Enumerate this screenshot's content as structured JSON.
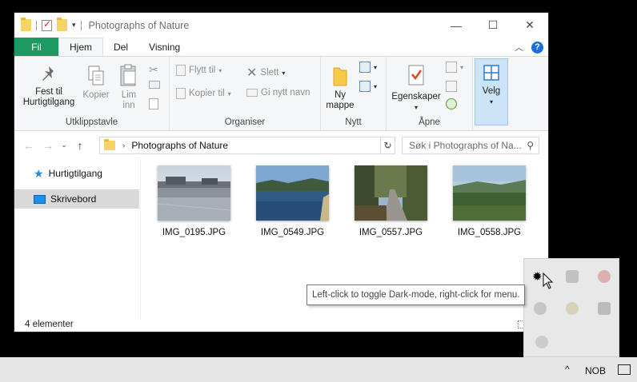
{
  "window": {
    "title": "Photographs of Nature",
    "controls": {
      "minimize": "—",
      "maximize": "☐",
      "close": "✕"
    }
  },
  "tabs": [
    {
      "label": "Fil"
    },
    {
      "label": "Hjem"
    },
    {
      "label": "Del"
    },
    {
      "label": "Visning"
    }
  ],
  "ribbon": {
    "clipboard": {
      "group_label": "Utklippstavle",
      "pin_line1": "Fest til",
      "pin_line2": "Hurtigtilgang",
      "copy": "Kopier",
      "paste_line1": "Lim",
      "paste_line2": "inn"
    },
    "organize": {
      "group_label": "Organiser",
      "move_to": "Flytt til",
      "copy_to": "Kopier til",
      "delete": "Slett",
      "rename": "Gi nytt navn"
    },
    "new": {
      "group_label": "Nytt",
      "new_folder_line1": "Ny",
      "new_folder_line2": "mappe"
    },
    "open": {
      "group_label": "Åpne",
      "properties": "Egenskaper"
    },
    "select": {
      "label": "Velg"
    }
  },
  "address": {
    "path": "Photographs of Nature",
    "search_placeholder": "Søk i Photographs of Na..."
  },
  "sidebar": {
    "items": [
      {
        "label": "Hurtigtilgang",
        "icon": "star-icon"
      },
      {
        "label": "Skrivebord",
        "icon": "desktop-icon",
        "selected": true
      }
    ]
  },
  "files": [
    {
      "name": "IMG_0195.JPG"
    },
    {
      "name": "IMG_0549.JPG"
    },
    {
      "name": "IMG_0557.JPG"
    },
    {
      "name": "IMG_0558.JPG"
    }
  ],
  "status": {
    "count": "4 elementer"
  },
  "tooltip": {
    "text": "Left-click to toggle Dark-mode, right-click for menu."
  },
  "taskbar": {
    "chevron": "^",
    "language": "NOB"
  },
  "colors": {
    "file_tab": "#1c9a62",
    "accent": "#1c6fd8",
    "selected_nav": "#d9d9d9"
  }
}
